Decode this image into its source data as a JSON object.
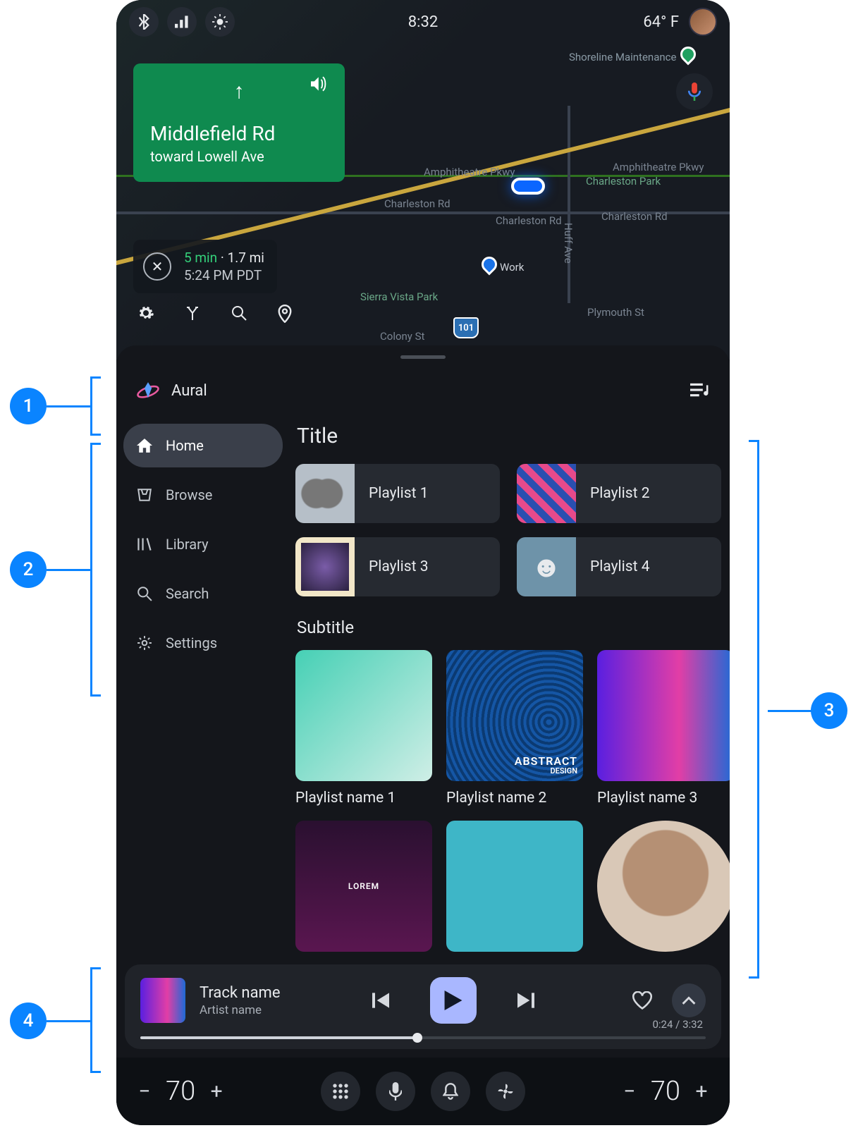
{
  "annotations": {
    "a1": "1",
    "a2": "2",
    "a3": "3",
    "a4": "4"
  },
  "status": {
    "time": "8:32",
    "temp": "64° F"
  },
  "nav": {
    "road": "Middlefield Rd",
    "toward": "toward Lowell Ave",
    "eta_dur": "5 min",
    "eta_dist": "1.7 mi",
    "eta_arrive": "5:24 PM PDT"
  },
  "map_labels": {
    "amph": "Amphitheatre Pkwy",
    "charleston": "Charleston Rd",
    "huff": "Huff Ave",
    "plymouth": "Plymouth St",
    "colony": "Colony St",
    "sierra": "Sierra Vista Park",
    "chpark": "Charleston Park",
    "shoreline": "Shoreline Maintenance",
    "work": "Work",
    "hwy": "101"
  },
  "app": {
    "name": "Aural"
  },
  "sidebar": {
    "items": [
      {
        "label": "Home"
      },
      {
        "label": "Browse"
      },
      {
        "label": "Library"
      },
      {
        "label": "Search"
      },
      {
        "label": "Settings"
      }
    ]
  },
  "content": {
    "title": "Title",
    "subtitle": "Subtitle",
    "playlists_small": [
      {
        "name": "Playlist 1"
      },
      {
        "name": "Playlist 2"
      },
      {
        "name": "Playlist 3"
      },
      {
        "name": "Playlist 4"
      }
    ],
    "playlists_big": [
      {
        "name": "Playlist name 1"
      },
      {
        "name": "Playlist name 2",
        "overlay": "ABSTRACT",
        "overlay2": "DESIGN"
      },
      {
        "name": "Playlist name 3"
      }
    ],
    "row3_overlay": "LOREM"
  },
  "now_playing": {
    "track": "Track name",
    "artist": "Artist name",
    "elapsed": "0:24",
    "total": "3:32",
    "progress_pct": 49
  },
  "sysbar": {
    "temp_left": "70",
    "temp_right": "70"
  }
}
